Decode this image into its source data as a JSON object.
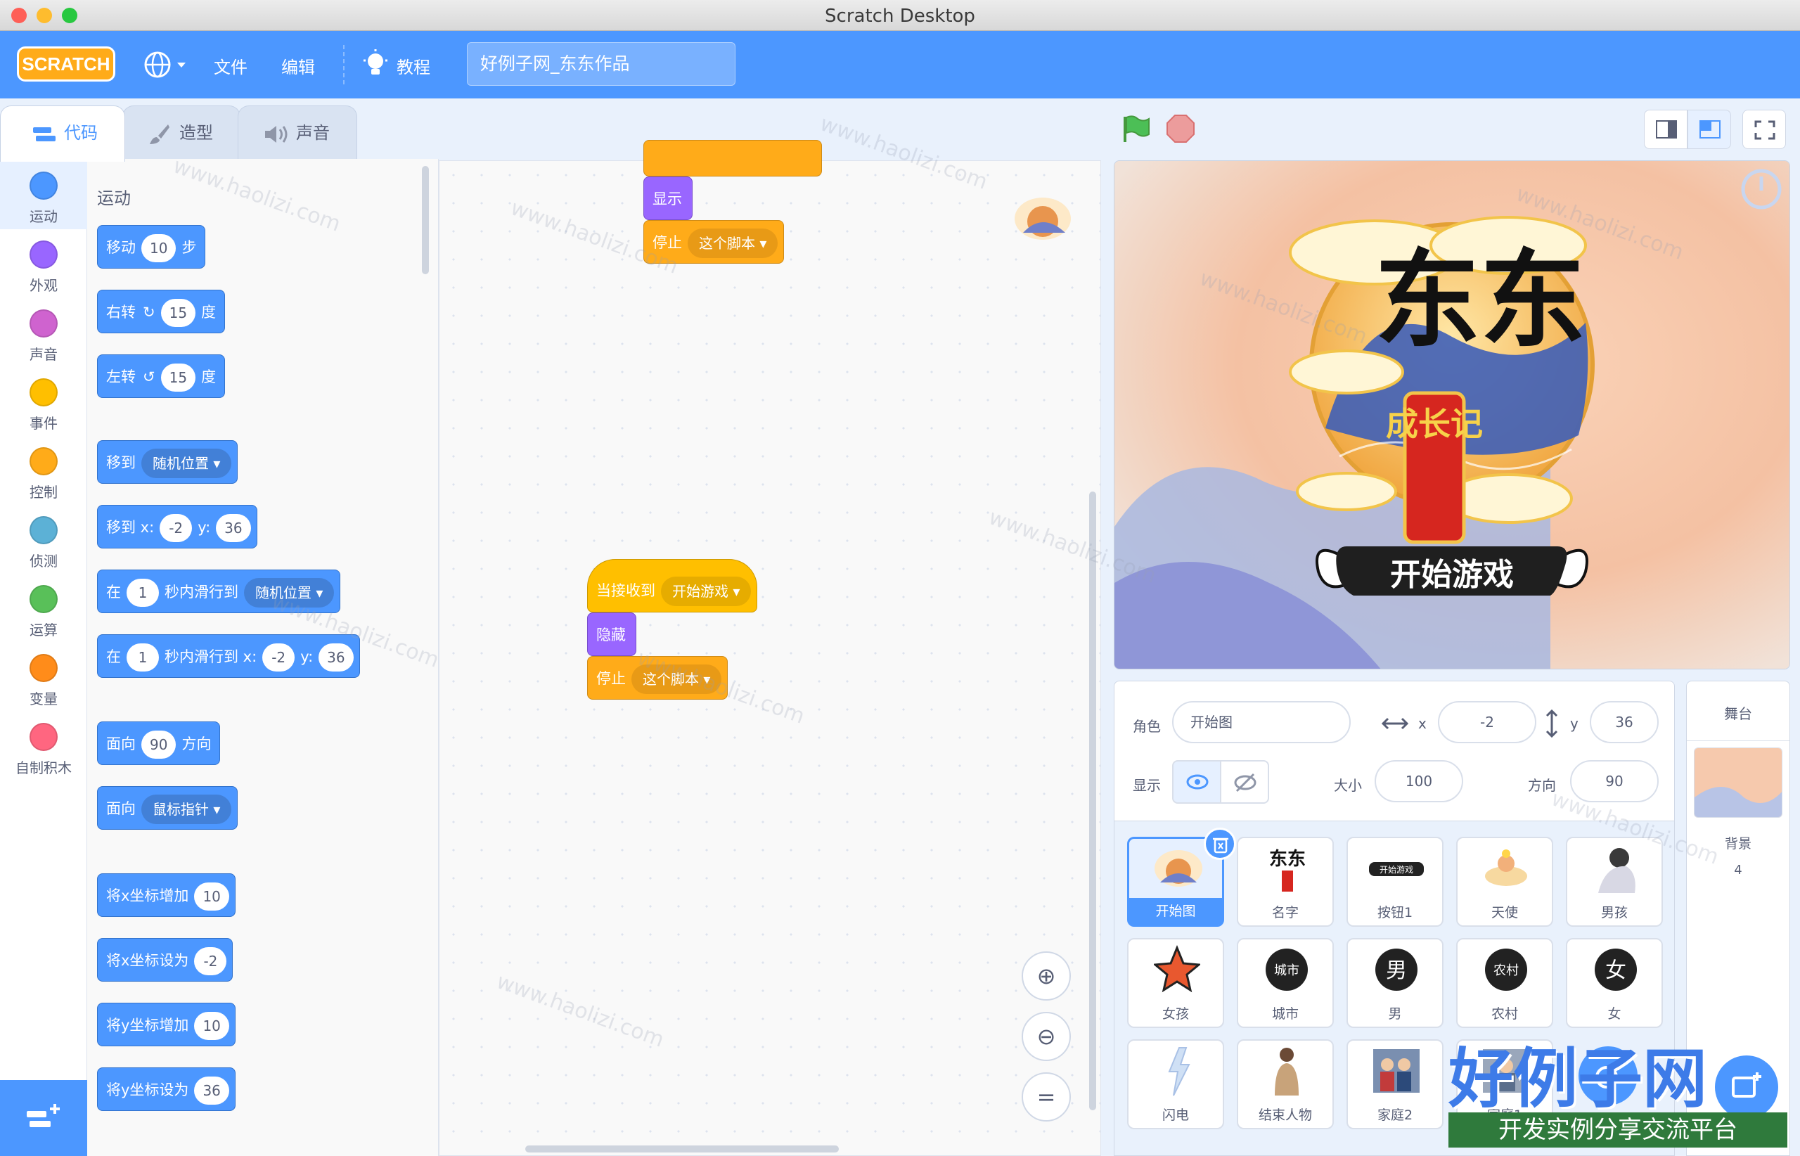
{
  "window": {
    "title": "Scratch Desktop"
  },
  "menubar": {
    "logo": "SCRATCH",
    "file": "文件",
    "edit": "编辑",
    "tutorials": "教程",
    "project_title": "好例子网_东东作品"
  },
  "tabs": [
    {
      "label": "代码",
      "icon": "code-icon"
    },
    {
      "label": "造型",
      "icon": "brush-icon"
    },
    {
      "label": "声音",
      "icon": "speaker-icon"
    }
  ],
  "categories": [
    {
      "label": "运动",
      "color": "#4c97ff"
    },
    {
      "label": "外观",
      "color": "#9966ff"
    },
    {
      "label": "声音",
      "color": "#cf63cf"
    },
    {
      "label": "事件",
      "color": "#ffbf00"
    },
    {
      "label": "控制",
      "color": "#ffab19"
    },
    {
      "label": "侦测",
      "color": "#5cb1d6"
    },
    {
      "label": "运算",
      "color": "#59c059"
    },
    {
      "label": "变量",
      "color": "#ff8c1a"
    },
    {
      "label": "自制积木",
      "color": "#ff6680"
    }
  ],
  "palette": {
    "heading": "运动",
    "move": {
      "pre": "移动",
      "val": "10",
      "post": "步"
    },
    "turn_right": {
      "pre": "右转",
      "val": "15",
      "post": "度"
    },
    "turn_left": {
      "pre": "左转",
      "val": "15",
      "post": "度"
    },
    "goto": {
      "pre": "移到",
      "dd": "随机位置"
    },
    "goto_xy": {
      "pre": "移到 x:",
      "x": "-2",
      "ylab": "y:",
      "y": "36"
    },
    "glide": {
      "pre": "在",
      "val": "1",
      "mid": "秒内滑行到",
      "dd": "随机位置"
    },
    "glide_xy": {
      "pre": "在",
      "val": "1",
      "mid": "秒内滑行到 x:",
      "x": "-2",
      "ylab": "y:",
      "y": "36"
    },
    "point_dir": {
      "pre": "面向",
      "val": "90",
      "post": "方向"
    },
    "point_towards": {
      "pre": "面向",
      "dd": "鼠标指针"
    },
    "change_x": {
      "pre": "将x坐标增加",
      "val": "10"
    },
    "set_x": {
      "pre": "将x坐标设为",
      "val": "-2"
    },
    "change_y": {
      "pre": "将y坐标增加",
      "val": "10"
    },
    "set_y": {
      "pre": "将y坐标设为",
      "val": "36"
    }
  },
  "scripts": {
    "s1_show": "显示",
    "s1_stop": "停止",
    "s1_stop_dd": "这个脚本",
    "s2_hat": "当接收到",
    "s2_hat_dd": "开始游戏",
    "s2_hide": "隐藏",
    "s2_stop": "停止",
    "s2_stop_dd": "这个脚本"
  },
  "stage": {
    "title_big": "东东",
    "title_sub": "成长记",
    "button": "开始游戏"
  },
  "sprite_info": {
    "sprite_label": "角色",
    "sprite_name": "开始图",
    "x_label": "x",
    "x": "-2",
    "y_label": "y",
    "y": "36",
    "show_label": "显示",
    "size_label": "大小",
    "size": "100",
    "direction_label": "方向",
    "direction": "90"
  },
  "sprites": [
    {
      "name": "开始图"
    },
    {
      "name": "名字"
    },
    {
      "name": "按钮1"
    },
    {
      "name": "天使"
    },
    {
      "name": "男孩"
    },
    {
      "name": "女孩"
    },
    {
      "name": "城市"
    },
    {
      "name": "男"
    },
    {
      "name": "农村"
    },
    {
      "name": "女"
    },
    {
      "name": "闪电"
    },
    {
      "name": "结束人物"
    },
    {
      "name": "家庭2"
    },
    {
      "name": "家庭1"
    }
  ],
  "sprite_badges": {
    "city": "城市",
    "male": "男",
    "village": "农村",
    "female": "女",
    "mini_button": "开始游戏"
  },
  "stage_pane": {
    "title": "舞台",
    "backdrop_label": "背景",
    "backdrop_count": "4"
  },
  "watermark": {
    "site": "www.haolizi.com",
    "brand": "好例子网",
    "slogan": "开发实例分享交流平台"
  },
  "colors": {
    "accent": "#4c97ff",
    "motion": "#4c97ff",
    "looks": "#9966ff",
    "events": "#ffbf00",
    "control": "#ffab19"
  }
}
